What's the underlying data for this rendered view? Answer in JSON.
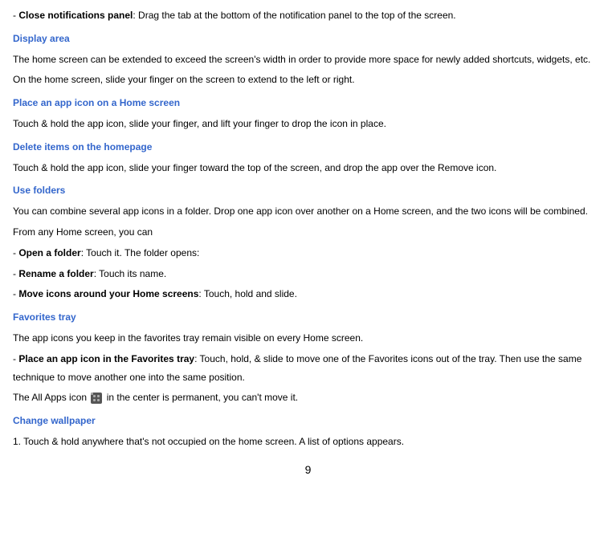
{
  "items": [
    {
      "type": "list",
      "bold": "Close notifications panel",
      "text": ": Drag the tab at the bottom of the notification panel to the top of the screen."
    },
    {
      "type": "heading",
      "text": "Display area"
    },
    {
      "type": "body",
      "text": "The home screen can be extended to exceed the screen's width in order to provide more space for newly added shortcuts, widgets, etc."
    },
    {
      "type": "body",
      "text": "On the home screen, slide your finger on the screen to extend to the left or right."
    },
    {
      "type": "heading",
      "text": "Place an app icon on a Home screen"
    },
    {
      "type": "body",
      "text": "Touch & hold the app icon, slide your finger, and lift your finger to drop the icon in place."
    },
    {
      "type": "heading",
      "text": "Delete items on the homepage"
    },
    {
      "type": "body",
      "text": "Touch & hold the app icon, slide your finger toward the top of the screen, and drop the app over the Remove icon."
    },
    {
      "type": "heading",
      "text": "Use folders"
    },
    {
      "type": "body",
      "text": "You can combine several app icons in a folder. Drop one app icon over another on a Home screen, and the two icons will be combined."
    },
    {
      "type": "body",
      "text": "From any Home screen, you can"
    },
    {
      "type": "list",
      "bold": "Open a folder",
      "text": ": Touch it. The folder opens:"
    },
    {
      "type": "list",
      "bold": "Rename a folder",
      "text": ": Touch its name."
    },
    {
      "type": "list",
      "bold": "Move icons around your Home screens",
      "text": ": Touch, hold and slide."
    },
    {
      "type": "heading",
      "text": "Favorites tray"
    },
    {
      "type": "body",
      "text": "The app icons you keep in the favorites tray remain visible on every Home screen."
    },
    {
      "type": "list",
      "bold": "Place an app icon in the Favorites tray",
      "text": ": Touch, hold, & slide to move one of the Favorites icons out of the tray. Then use the same technique to move another one into the same position."
    },
    {
      "type": "icon-line",
      "pre": "The All Apps icon ",
      "post": " in the center is permanent, you can't move it."
    },
    {
      "type": "heading",
      "text": "Change wallpaper"
    },
    {
      "type": "body",
      "text": "1. Touch & hold anywhere that's not occupied on the home screen. A list of options appears."
    }
  ],
  "page_number": "9"
}
